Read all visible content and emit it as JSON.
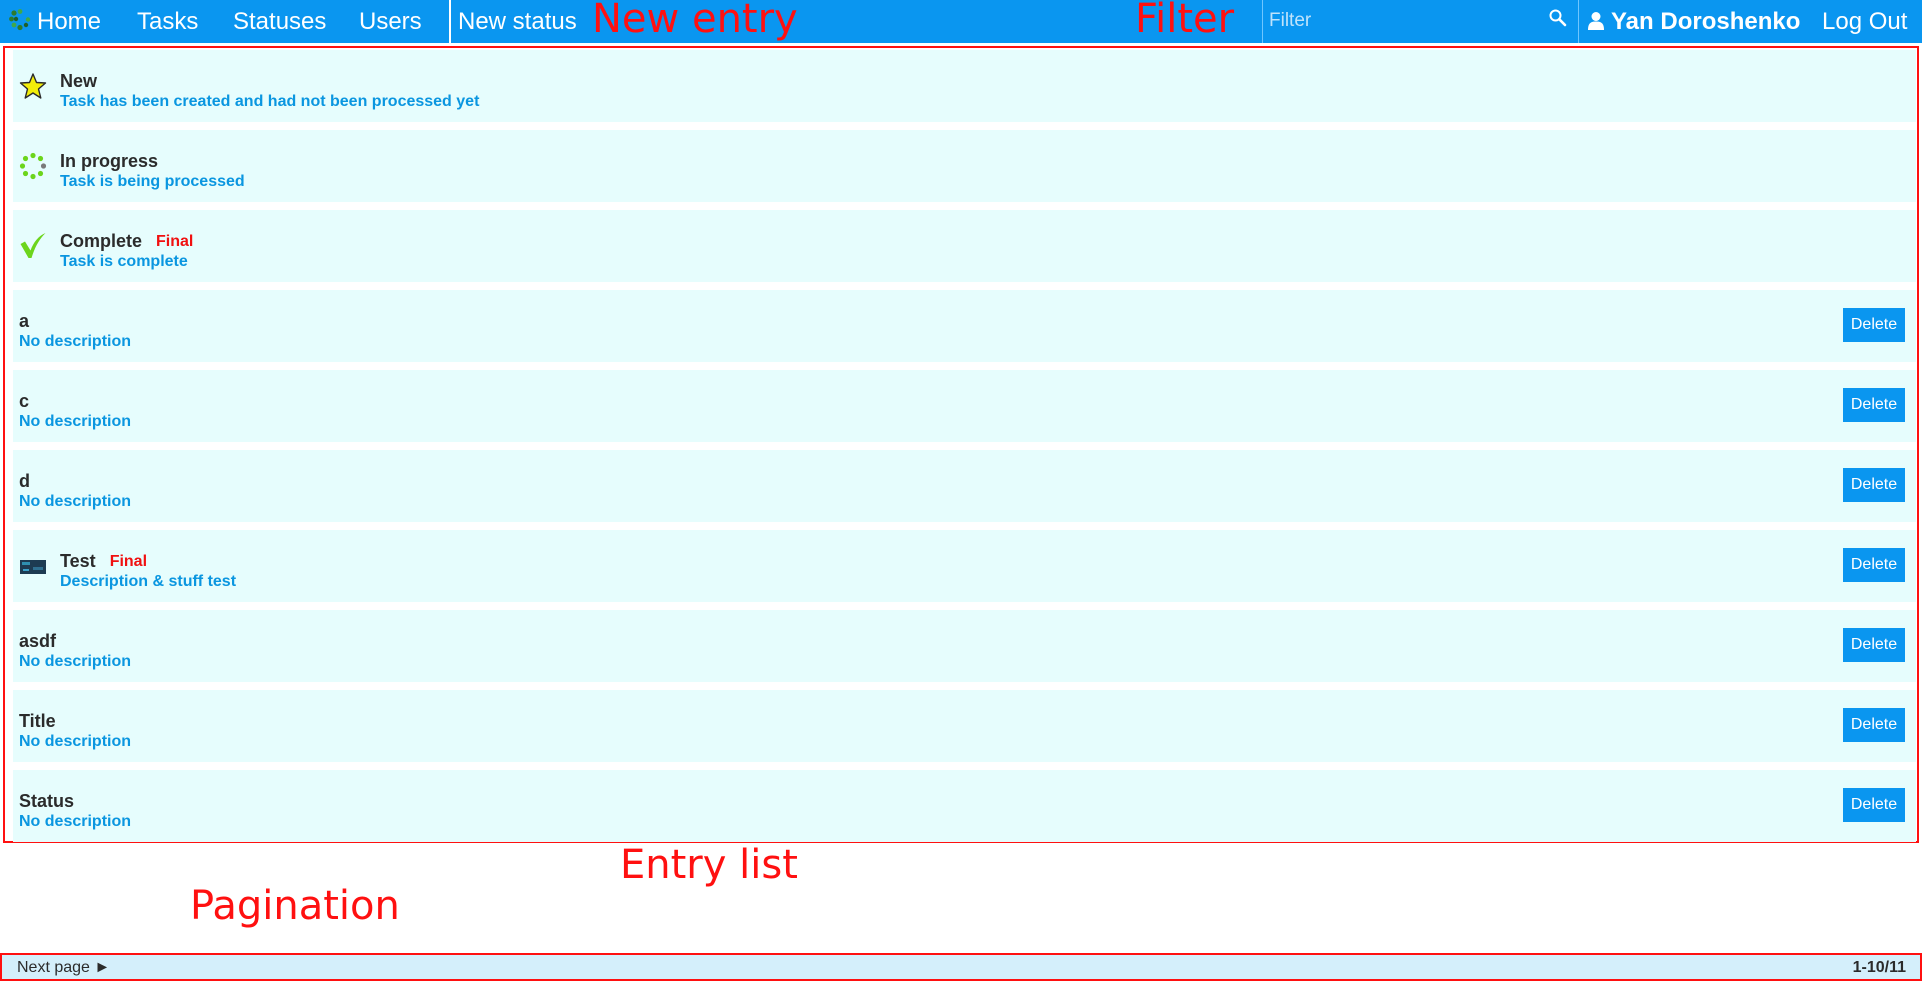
{
  "nav": {
    "home": "Home",
    "tasks": "Tasks",
    "statuses": "Statuses",
    "users": "Users",
    "new_status": "New status",
    "user_name": "Yan Doroshenko",
    "logout": "Log Out"
  },
  "filter": {
    "placeholder": "Filter",
    "value": ""
  },
  "annotations": {
    "new_entry": "New entry",
    "filter": "Filter",
    "entry_list": "Entry list",
    "pagination": "Pagination"
  },
  "entries": [
    {
      "title": "New",
      "description": "Task has been created and had not been processed yet",
      "final": "",
      "icon": "star-icon",
      "delete": ""
    },
    {
      "title": "In progress",
      "description": "Task is being processed",
      "final": "",
      "icon": "spinner-icon",
      "delete": ""
    },
    {
      "title": "Complete",
      "description": "Task is complete",
      "final": "Final",
      "icon": "checkmark-icon",
      "delete": ""
    },
    {
      "title": "a",
      "description": "No description",
      "final": "",
      "icon": "",
      "delete": "Delete"
    },
    {
      "title": "c",
      "description": "No description",
      "final": "",
      "icon": "",
      "delete": "Delete"
    },
    {
      "title": "d",
      "description": "No description",
      "final": "",
      "icon": "",
      "delete": "Delete"
    },
    {
      "title": "Test",
      "description": "Description & stuff test",
      "final": "Final",
      "icon": "image-thumbnail-icon",
      "delete": "Delete"
    },
    {
      "title": "asdf",
      "description": "No description",
      "final": "",
      "icon": "",
      "delete": "Delete"
    },
    {
      "title": "Title",
      "description": "No description",
      "final": "",
      "icon": "",
      "delete": "Delete"
    },
    {
      "title": "Status",
      "description": "No description",
      "final": "",
      "icon": "",
      "delete": "Delete"
    }
  ],
  "pagination": {
    "next": "Next page ►",
    "range": "1-10/11"
  },
  "colors": {
    "topbar": "#0a96f0",
    "entry_bg": "#e6fdfd",
    "description": "#0a96e0",
    "final": "#f01010",
    "annotation": "#ff1010",
    "pagination_bg": "#d4effb"
  }
}
